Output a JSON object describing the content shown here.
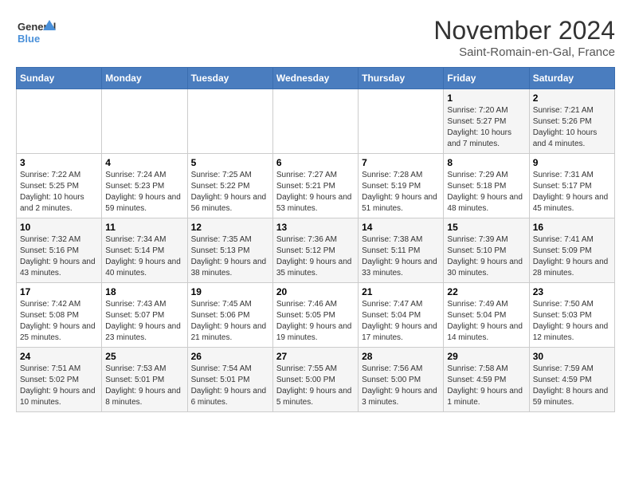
{
  "header": {
    "logo_line1": "General",
    "logo_line2": "Blue",
    "month_title": "November 2024",
    "subtitle": "Saint-Romain-en-Gal, France"
  },
  "weekdays": [
    "Sunday",
    "Monday",
    "Tuesday",
    "Wednesday",
    "Thursday",
    "Friday",
    "Saturday"
  ],
  "weeks": [
    [
      {
        "day": "",
        "info": ""
      },
      {
        "day": "",
        "info": ""
      },
      {
        "day": "",
        "info": ""
      },
      {
        "day": "",
        "info": ""
      },
      {
        "day": "",
        "info": ""
      },
      {
        "day": "1",
        "info": "Sunrise: 7:20 AM\nSunset: 5:27 PM\nDaylight: 10 hours and 7 minutes."
      },
      {
        "day": "2",
        "info": "Sunrise: 7:21 AM\nSunset: 5:26 PM\nDaylight: 10 hours and 4 minutes."
      }
    ],
    [
      {
        "day": "3",
        "info": "Sunrise: 7:22 AM\nSunset: 5:25 PM\nDaylight: 10 hours and 2 minutes."
      },
      {
        "day": "4",
        "info": "Sunrise: 7:24 AM\nSunset: 5:23 PM\nDaylight: 9 hours and 59 minutes."
      },
      {
        "day": "5",
        "info": "Sunrise: 7:25 AM\nSunset: 5:22 PM\nDaylight: 9 hours and 56 minutes."
      },
      {
        "day": "6",
        "info": "Sunrise: 7:27 AM\nSunset: 5:21 PM\nDaylight: 9 hours and 53 minutes."
      },
      {
        "day": "7",
        "info": "Sunrise: 7:28 AM\nSunset: 5:19 PM\nDaylight: 9 hours and 51 minutes."
      },
      {
        "day": "8",
        "info": "Sunrise: 7:29 AM\nSunset: 5:18 PM\nDaylight: 9 hours and 48 minutes."
      },
      {
        "day": "9",
        "info": "Sunrise: 7:31 AM\nSunset: 5:17 PM\nDaylight: 9 hours and 45 minutes."
      }
    ],
    [
      {
        "day": "10",
        "info": "Sunrise: 7:32 AM\nSunset: 5:16 PM\nDaylight: 9 hours and 43 minutes."
      },
      {
        "day": "11",
        "info": "Sunrise: 7:34 AM\nSunset: 5:14 PM\nDaylight: 9 hours and 40 minutes."
      },
      {
        "day": "12",
        "info": "Sunrise: 7:35 AM\nSunset: 5:13 PM\nDaylight: 9 hours and 38 minutes."
      },
      {
        "day": "13",
        "info": "Sunrise: 7:36 AM\nSunset: 5:12 PM\nDaylight: 9 hours and 35 minutes."
      },
      {
        "day": "14",
        "info": "Sunrise: 7:38 AM\nSunset: 5:11 PM\nDaylight: 9 hours and 33 minutes."
      },
      {
        "day": "15",
        "info": "Sunrise: 7:39 AM\nSunset: 5:10 PM\nDaylight: 9 hours and 30 minutes."
      },
      {
        "day": "16",
        "info": "Sunrise: 7:41 AM\nSunset: 5:09 PM\nDaylight: 9 hours and 28 minutes."
      }
    ],
    [
      {
        "day": "17",
        "info": "Sunrise: 7:42 AM\nSunset: 5:08 PM\nDaylight: 9 hours and 25 minutes."
      },
      {
        "day": "18",
        "info": "Sunrise: 7:43 AM\nSunset: 5:07 PM\nDaylight: 9 hours and 23 minutes."
      },
      {
        "day": "19",
        "info": "Sunrise: 7:45 AM\nSunset: 5:06 PM\nDaylight: 9 hours and 21 minutes."
      },
      {
        "day": "20",
        "info": "Sunrise: 7:46 AM\nSunset: 5:05 PM\nDaylight: 9 hours and 19 minutes."
      },
      {
        "day": "21",
        "info": "Sunrise: 7:47 AM\nSunset: 5:04 PM\nDaylight: 9 hours and 17 minutes."
      },
      {
        "day": "22",
        "info": "Sunrise: 7:49 AM\nSunset: 5:04 PM\nDaylight: 9 hours and 14 minutes."
      },
      {
        "day": "23",
        "info": "Sunrise: 7:50 AM\nSunset: 5:03 PM\nDaylight: 9 hours and 12 minutes."
      }
    ],
    [
      {
        "day": "24",
        "info": "Sunrise: 7:51 AM\nSunset: 5:02 PM\nDaylight: 9 hours and 10 minutes."
      },
      {
        "day": "25",
        "info": "Sunrise: 7:53 AM\nSunset: 5:01 PM\nDaylight: 9 hours and 8 minutes."
      },
      {
        "day": "26",
        "info": "Sunrise: 7:54 AM\nSunset: 5:01 PM\nDaylight: 9 hours and 6 minutes."
      },
      {
        "day": "27",
        "info": "Sunrise: 7:55 AM\nSunset: 5:00 PM\nDaylight: 9 hours and 5 minutes."
      },
      {
        "day": "28",
        "info": "Sunrise: 7:56 AM\nSunset: 5:00 PM\nDaylight: 9 hours and 3 minutes."
      },
      {
        "day": "29",
        "info": "Sunrise: 7:58 AM\nSunset: 4:59 PM\nDaylight: 9 hours and 1 minute."
      },
      {
        "day": "30",
        "info": "Sunrise: 7:59 AM\nSunset: 4:59 PM\nDaylight: 8 hours and 59 minutes."
      }
    ]
  ]
}
